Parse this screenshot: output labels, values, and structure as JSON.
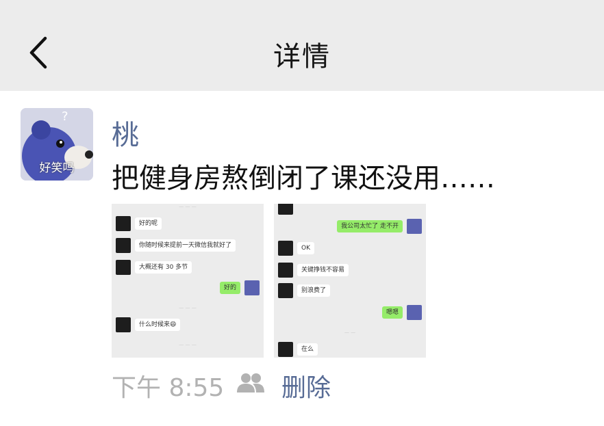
{
  "navbar": {
    "title": "详情",
    "back_icon": "chevron-left-icon"
  },
  "post": {
    "avatar_caption": "好笑吗",
    "avatar_badge": "?",
    "username": "桃",
    "text": "把健身房熬倒闭了课还没用……",
    "time": "下午 8:55",
    "delete_label": "删除",
    "visibility_icon": "people-icon"
  },
  "photo1": {
    "messages": [
      {
        "side": "left",
        "text": "好的呢"
      },
      {
        "side": "left",
        "text": "你随时候来提前一天微信我就好了"
      },
      {
        "side": "left",
        "text": "大概还有 30 多节"
      },
      {
        "side": "right",
        "text": "好的"
      },
      {
        "side": "left",
        "text": "什么时候来😄"
      }
    ]
  },
  "photo2": {
    "messages": [
      {
        "side": "right",
        "text": "我公司太忙了 走不开"
      },
      {
        "side": "left",
        "text": "OK"
      },
      {
        "side": "left",
        "text": "关键挣钱不容易"
      },
      {
        "side": "left",
        "text": "别浪费了"
      },
      {
        "side": "right",
        "text": "嗯嗯"
      },
      {
        "side": "left",
        "text": "在么"
      }
    ]
  },
  "colors": {
    "link": "#576b95",
    "navbar_bg": "#ececec",
    "bubble_green": "#95ec69"
  }
}
